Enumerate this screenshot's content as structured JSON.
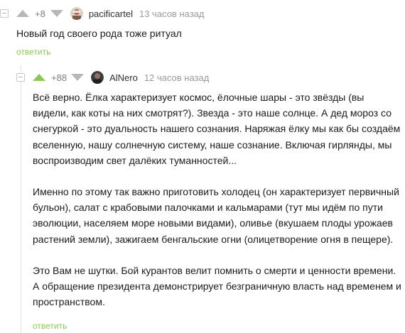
{
  "comments": [
    {
      "rating": "+8",
      "username": "pacificartel",
      "time": "13 часов назад",
      "text": [
        "Новый год своего рода тоже ритуал"
      ],
      "reply_label": "ответить"
    },
    {
      "rating": "+88",
      "username": "AlNero",
      "time": "12 часов назад",
      "text": [
        "Всё верно. Ёлка характеризует космос, ёлочные шары - это звёзды (вы видели, как коты на них смотрят?). Звезда - это наше солнце. А дед мороз со снегуркой - это дуальность нашего сознания. Наряжая ёлку мы как бы создаём вселенную, нашу солнечную систему, наше сознание. Включая гирлянды, мы воспроизводим свет далёких туманностей...",
        "Именно по этому так важно приготовить холодец (он характеризует первичный бульон), салат с крабовыми палочками и кальмарами (тут мы идём по пути эволюции, населяем море новыми видами), оливье (вкушаем плоды урожаев растений земли), зажигаем бенгальские огни (олицетворение огня в пещере).",
        "Это Вам не шутки. Бой курантов велит помнить о смерти и ценности времени. А обращение президента демонстрирует безграничную власть над временем и пространством."
      ],
      "reply_label": "ответить"
    }
  ],
  "colors": {
    "upvote_active": "#8ac858",
    "reply_link": "#8ac858",
    "muted": "#b8b8b8"
  }
}
